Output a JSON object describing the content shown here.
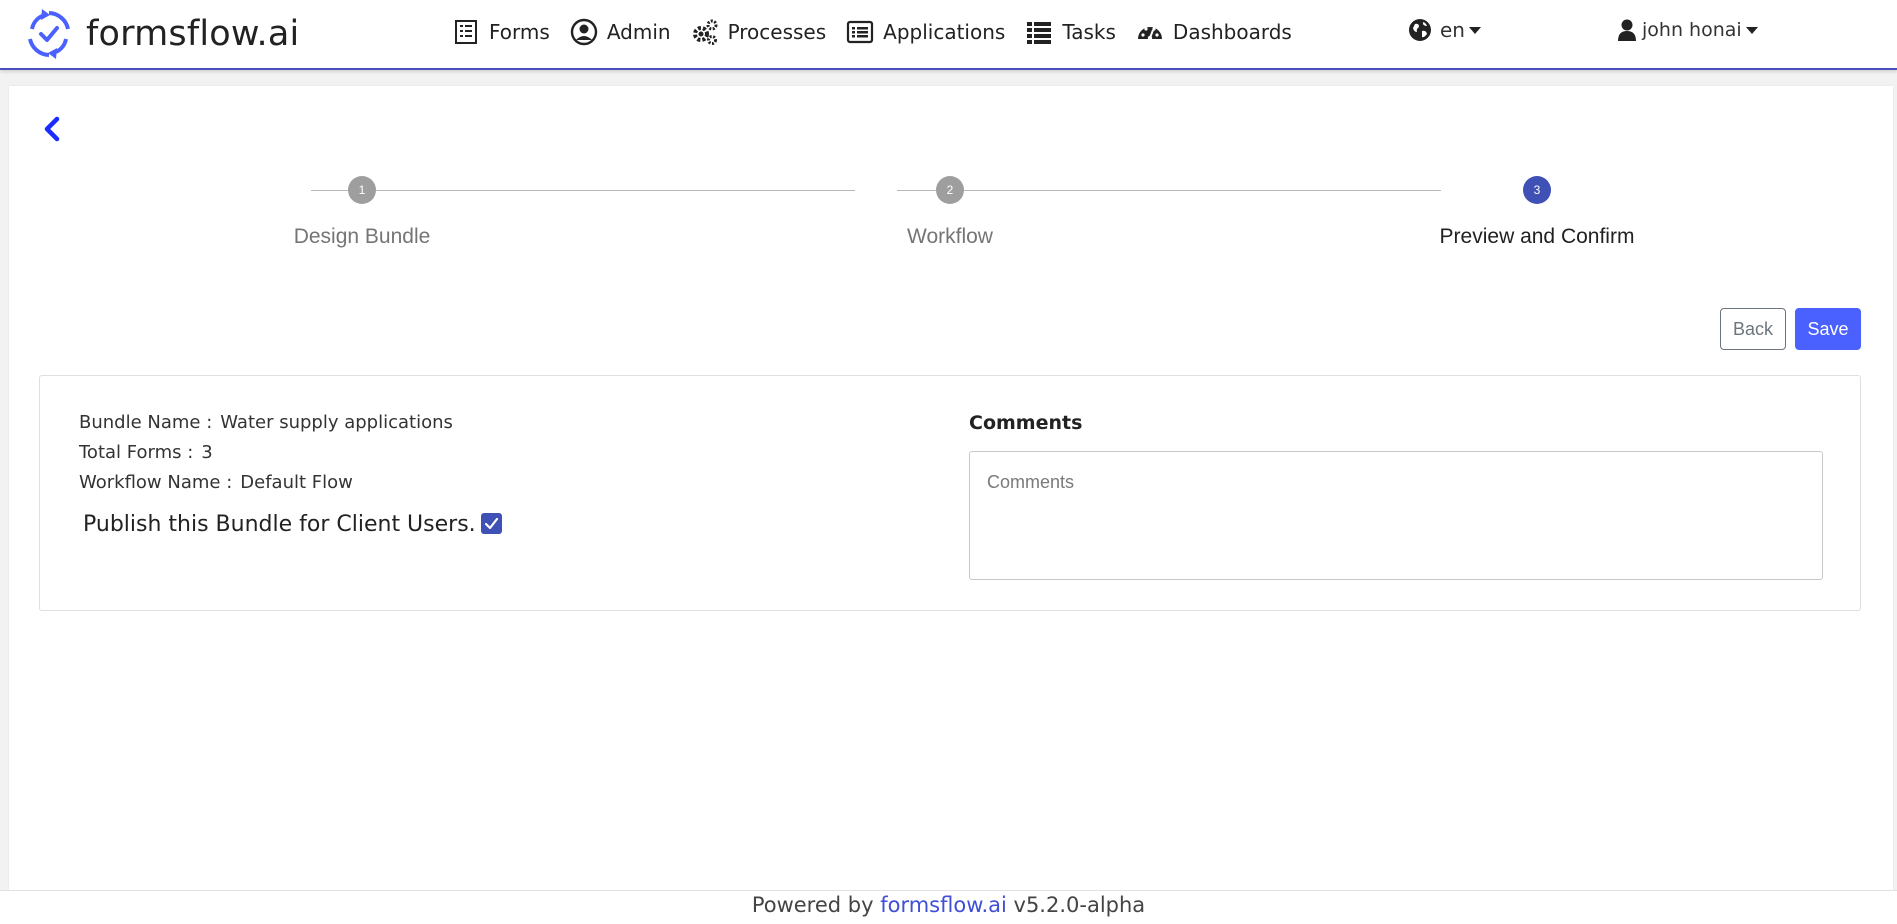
{
  "brand": {
    "name": "formsflow.ai"
  },
  "nav": {
    "items": [
      {
        "label": "Forms",
        "icon": "forms-icon"
      },
      {
        "label": "Admin",
        "icon": "user-circle-icon"
      },
      {
        "label": "Processes",
        "icon": "cogs-icon"
      },
      {
        "label": "Applications",
        "icon": "list-alt-icon"
      },
      {
        "label": "Tasks",
        "icon": "list-icon"
      },
      {
        "label": "Dashboards",
        "icon": "tachometer-icon"
      }
    ],
    "language": "en",
    "user": "john honai"
  },
  "stepper": {
    "steps": [
      {
        "number": "1",
        "label": "Design Bundle",
        "state": "inactive"
      },
      {
        "number": "2",
        "label": "Workflow",
        "state": "inactive"
      },
      {
        "number": "3",
        "label": "Preview and Confirm",
        "state": "active"
      }
    ]
  },
  "actions": {
    "back_label": "Back",
    "save_label": "Save"
  },
  "summary": {
    "bundle_name_label": "Bundle Name :",
    "bundle_name_value": "Water supply applications",
    "total_forms_label": "Total Forms :",
    "total_forms_value": "3",
    "workflow_name_label": "Workflow Name :",
    "workflow_name_value": "Default Flow",
    "publish_label": "Publish this Bundle for Client Users.",
    "publish_checked": true
  },
  "comments": {
    "label": "Comments",
    "placeholder": "Comments",
    "value": ""
  },
  "footer": {
    "prefix": "Powered by",
    "link": "formsflow.ai",
    "version": "v5.2.0-alpha"
  },
  "colors": {
    "accent": "#4a61ff",
    "active_step": "#3f51b5",
    "inactive_step": "#9e9e9e",
    "header_border": "#4a4fbd"
  }
}
